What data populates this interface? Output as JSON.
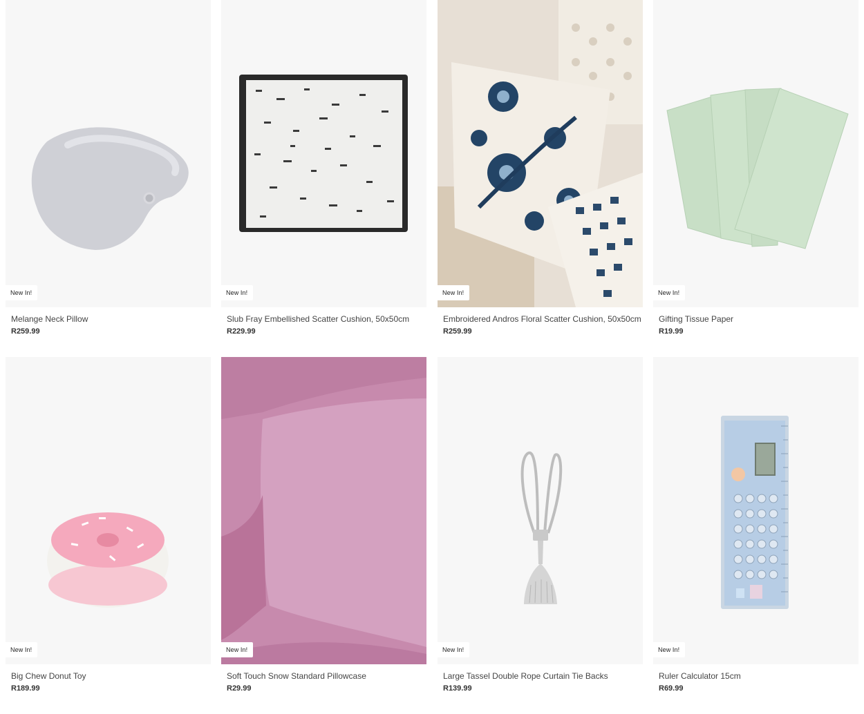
{
  "products": [
    {
      "name": "Melange Neck Pillow",
      "price": "R259.99",
      "badge": "New In!",
      "image": "neck-pillow"
    },
    {
      "name": "Slub Fray Embellished Scatter Cushion, 50x50cm",
      "price": "R229.99",
      "badge": "New In!",
      "image": "fray-cushion"
    },
    {
      "name": "Embroidered Andros Floral Scatter Cushion, 50x50cm",
      "price": "R259.99",
      "badge": "New In!",
      "image": "floral-cushion"
    },
    {
      "name": "Gifting Tissue Paper",
      "price": "R19.99",
      "badge": "New In!",
      "image": "tissue-paper"
    },
    {
      "name": "Big Chew Donut Toy",
      "price": "R189.99",
      "badge": "New In!",
      "image": "donut-toy"
    },
    {
      "name": "Soft Touch Snow Standard Pillowcase",
      "price": "R29.99",
      "badge": "New In!",
      "image": "pillowcase"
    },
    {
      "name": "Large Tassel Double Rope Curtain Tie Backs",
      "price": "R139.99",
      "badge": "New In!",
      "image": "tassel-tieback"
    },
    {
      "name": "Ruler Calculator 15cm",
      "price": "R69.99",
      "badge": "New In!",
      "image": "ruler-calculator"
    }
  ]
}
